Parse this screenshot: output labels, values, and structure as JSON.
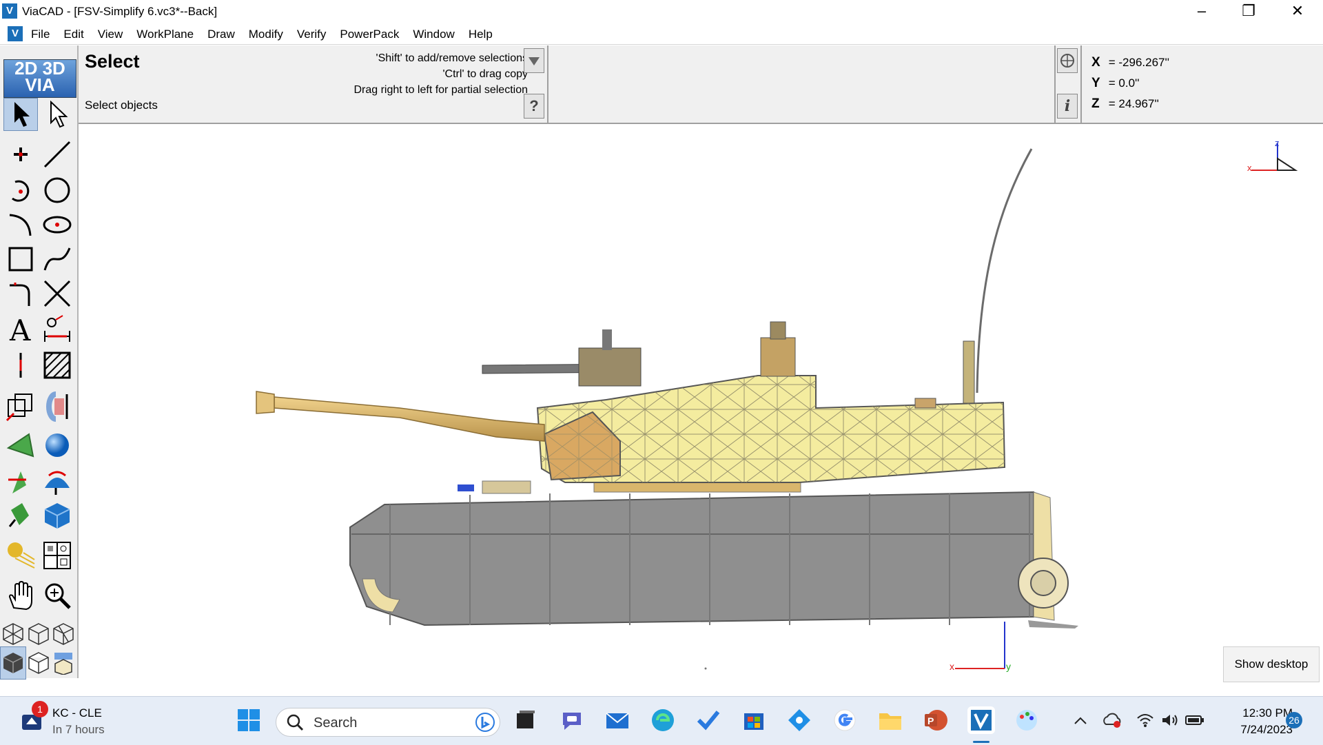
{
  "window": {
    "app_icon": "V",
    "title": "ViaCAD - [FSV-Simplify 6.vc3*--Back]",
    "controls": [
      "–",
      "❐",
      "✕"
    ]
  },
  "menubar": {
    "items": [
      "File",
      "Edit",
      "View",
      "WorkPlane",
      "Draw",
      "Modify",
      "Verify",
      "PowerPack",
      "Window",
      "Help"
    ],
    "mdi_controls": [
      "–",
      "▭",
      "✕"
    ]
  },
  "logo": {
    "line1": "2D 3D",
    "line2": "VIA"
  },
  "prompt": {
    "title": "Select",
    "subtitle": "Select objects",
    "hints": [
      "'Shift' to add/remove selections",
      "'Ctrl' to drag copy",
      "Drag right to left for partial selection"
    ],
    "help_symbol": "?",
    "info_symbol": "i"
  },
  "coords": {
    "x_label": "X",
    "x_value": "= -296.267''",
    "y_label": "Y",
    "y_value": "= 0.0''",
    "z_label": "Z",
    "z_value": "= 24.967''"
  },
  "viewport": {
    "axis_triad": {
      "z": "z",
      "x": "x"
    },
    "origin_marker": {
      "x": "x",
      "y": "y"
    }
  },
  "show_desktop": "Show desktop",
  "taskbar": {
    "weather": {
      "title": "KC - CLE",
      "subtitle": "In 7 hours",
      "badge": "1"
    },
    "search_placeholder": "Search",
    "clock": {
      "time": "12:30 PM",
      "date": "7/24/2023"
    },
    "notification_count": "26"
  },
  "colors": {
    "turret": "#f4ec9f",
    "hull": "#8c8c8c",
    "barrel": "#d7b36a",
    "selection": "#b9cfe9",
    "accent": "#1b6fb8"
  }
}
